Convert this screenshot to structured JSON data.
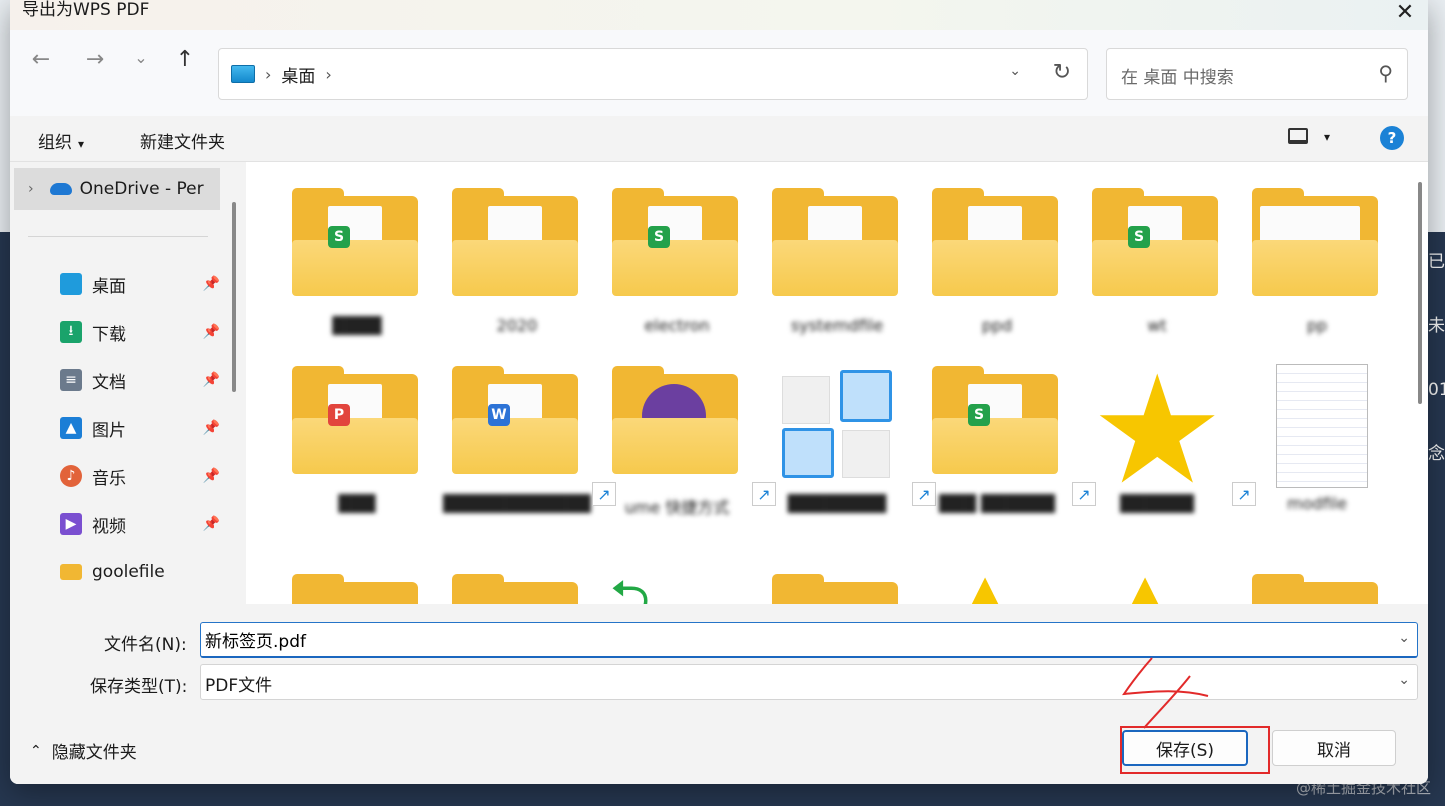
{
  "dialog": {
    "title": "导出为WPS PDF",
    "close_glyph": "✕"
  },
  "nav": {
    "back_glyph": "←",
    "forward_glyph": "→",
    "recent_glyph": "⌄",
    "up_glyph": "↑",
    "address_sep": "›",
    "address_location": "桌面",
    "address_dropdown_glyph": "⌄",
    "refresh_glyph": "↻",
    "search_placeholder": "在 桌面 中搜索",
    "search_glyph": "⚲"
  },
  "commandbar": {
    "organize": "组织",
    "organize_caret": "▾",
    "new_folder": "新建文件夹",
    "view_caret": "▾",
    "help": "?"
  },
  "sidebar": {
    "onedrive_chevron": "›",
    "onedrive_label": "OneDrive - Per",
    "pin_glyph": "📌",
    "items": [
      {
        "label": "桌面",
        "color": "#1f9bdc",
        "glyph": ""
      },
      {
        "label": "下载",
        "color": "#1aa36b",
        "glyph": "⭳"
      },
      {
        "label": "文档",
        "color": "#6b7a8c",
        "glyph": "≡"
      },
      {
        "label": "图片",
        "color": "#1b7ed6",
        "glyph": "▲"
      },
      {
        "label": "音乐",
        "color": "#e2633a",
        "glyph": "♪"
      },
      {
        "label": "视频",
        "color": "#7a4fd0",
        "glyph": "▶"
      },
      {
        "label": "goolefile",
        "color": "#f1b733",
        "glyph": ""
      }
    ]
  },
  "content": {
    "shortcut_glyph": "↗",
    "row1": [
      {
        "label": "████",
        "badge": "S",
        "badge_color": "#24a14b"
      },
      {
        "label": "2020",
        "badge": "",
        "badge_color": ""
      },
      {
        "label": "electron",
        "badge": "S",
        "badge_color": "#24a14b"
      },
      {
        "label": "systemdfile",
        "badge": "",
        "badge_color": ""
      },
      {
        "label": "ppd",
        "badge": "",
        "badge_color": ""
      },
      {
        "label": "wt",
        "badge": "S",
        "badge_color": "#24a14b"
      },
      {
        "label": "pp",
        "badge": "",
        "badge_color": ""
      }
    ],
    "row2": [
      {
        "label": "███",
        "badge": "P",
        "badge_color": "#e2453d",
        "kind": "folder"
      },
      {
        "label": "████████████",
        "badge": "W",
        "badge_color": "#2d73d6",
        "kind": "folder"
      },
      {
        "label": "ume 快捷方式",
        "badge": "",
        "badge_color": "",
        "kind": "folder-shortcut"
      },
      {
        "label": "████████",
        "badge": "",
        "badge_color": "",
        "kind": "app-shortcut"
      },
      {
        "label": "███ ██████",
        "badge": "S",
        "badge_color": "#24a14b",
        "kind": "folder-shortcut"
      },
      {
        "label": "██████",
        "badge": "",
        "badge_color": "",
        "kind": "star-shortcut"
      },
      {
        "label": "modfile",
        "badge": "",
        "badge_color": "",
        "kind": "doc-shortcut"
      }
    ]
  },
  "form": {
    "filename_label": "文件名(N):",
    "filename_value": "新标签页.pdf",
    "filename_dropdown_glyph": "⌄",
    "filetype_label": "保存类型(T):",
    "filetype_value": "PDF文件",
    "filetype_dropdown_glyph": "⌄"
  },
  "footer": {
    "hide_caret": "⌃",
    "hide_label": "隐藏文件夹",
    "save_label": "保存(S)",
    "cancel_label": "取消"
  },
  "desktop": {
    "right_text": "已 未 01 念",
    "watermark": "@稀土掘金技术社区"
  },
  "colors": {
    "accent": "#1b67bf",
    "highlight": "#e22a2a",
    "folder": "#f1b733"
  }
}
